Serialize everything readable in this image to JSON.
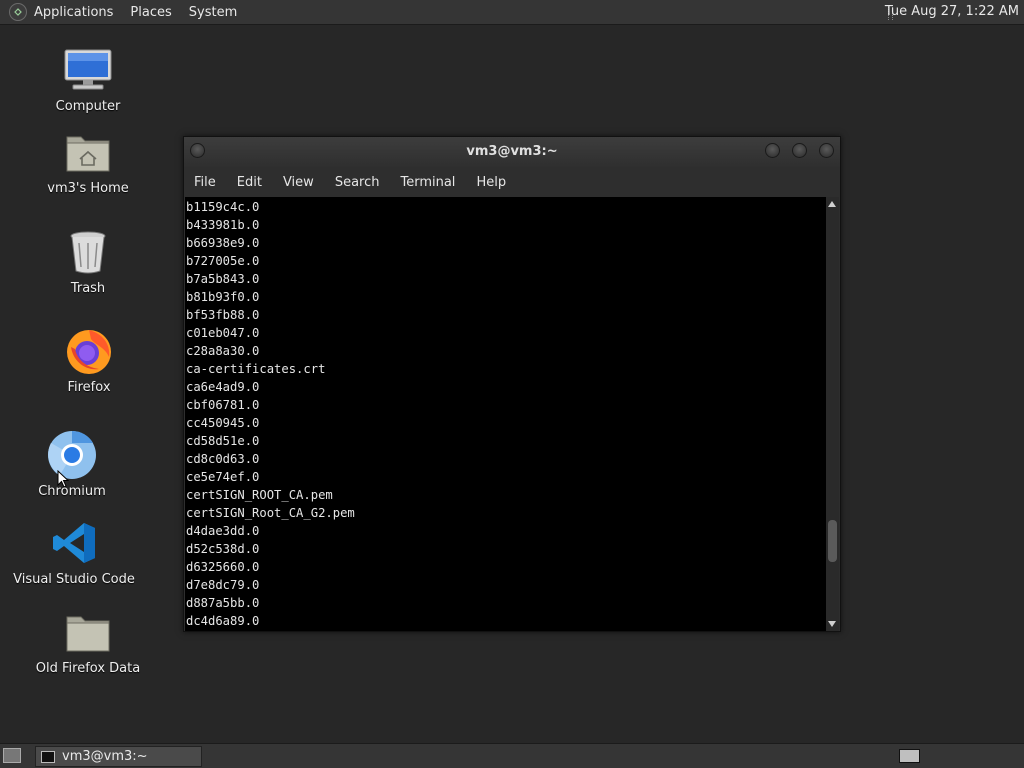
{
  "top_panel": {
    "menus": [
      "Applications",
      "Places",
      "System"
    ],
    "clock": "Tue Aug 27,  1:22 AM"
  },
  "desktop": {
    "icons": [
      {
        "label": "Computer",
        "icon": "computer-icon"
      },
      {
        "label": "vm3's Home",
        "icon": "home-folder-icon"
      },
      {
        "label": "Trash",
        "icon": "trash-icon"
      },
      {
        "label": "Firefox",
        "icon": "firefox-icon"
      },
      {
        "label": "Chromium",
        "icon": "chromium-icon"
      },
      {
        "label": "Visual Studio Code",
        "icon": "vscode-icon"
      },
      {
        "label": "Old Firefox Data",
        "icon": "folder-icon"
      }
    ]
  },
  "terminal": {
    "title": "vm3@vm3:~",
    "menu": [
      "File",
      "Edit",
      "View",
      "Search",
      "Terminal",
      "Help"
    ],
    "lines": [
      "b1159c4c.0",
      "b433981b.0",
      "b66938e9.0",
      "b727005e.0",
      "b7a5b843.0",
      "b81b93f0.0",
      "bf53fb88.0",
      "c01eb047.0",
      "c28a8a30.0",
      "ca-certificates.crt",
      "ca6e4ad9.0",
      "cbf06781.0",
      "cc450945.0",
      "cd58d51e.0",
      "cd8c0d63.0",
      "ce5e74ef.0",
      "certSIGN_ROOT_CA.pem",
      "certSIGN_Root_CA_G2.pem",
      "d4dae3dd.0",
      "d52c538d.0",
      "d6325660.0",
      "d7e8dc79.0",
      "d887a5bb.0",
      "dc4d6a89.0"
    ],
    "scroll_position_fraction": 0.85
  },
  "bottom_panel": {
    "task_label": "vm3@vm3:~"
  },
  "colors": {
    "desktop_bg": "#272727",
    "panel_bg": "#353535",
    "terminal_bg": "#000000",
    "terminal_fg": "#e6e6e6"
  }
}
